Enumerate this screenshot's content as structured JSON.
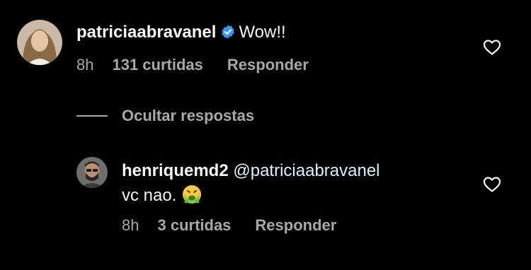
{
  "comment": {
    "username": "patriciaabravanel",
    "text": "Wow!!",
    "time": "8h",
    "likes": "131 curtidas",
    "reply_label": "Responder",
    "verified": true
  },
  "hide_replies_label": "Ocultar respostas",
  "reply": {
    "username": "henriquemd2",
    "mention": "@patriciaabravanel",
    "text": "vc nao.",
    "emoji": "nauseated-face",
    "time": "8h",
    "likes": "3 curtidas",
    "reply_label": "Responder"
  },
  "colors": {
    "background": "#000000",
    "primary_text": "#f5f5f5",
    "secondary_text": "#a8a8a8",
    "verified_badge": "#3897f0"
  }
}
